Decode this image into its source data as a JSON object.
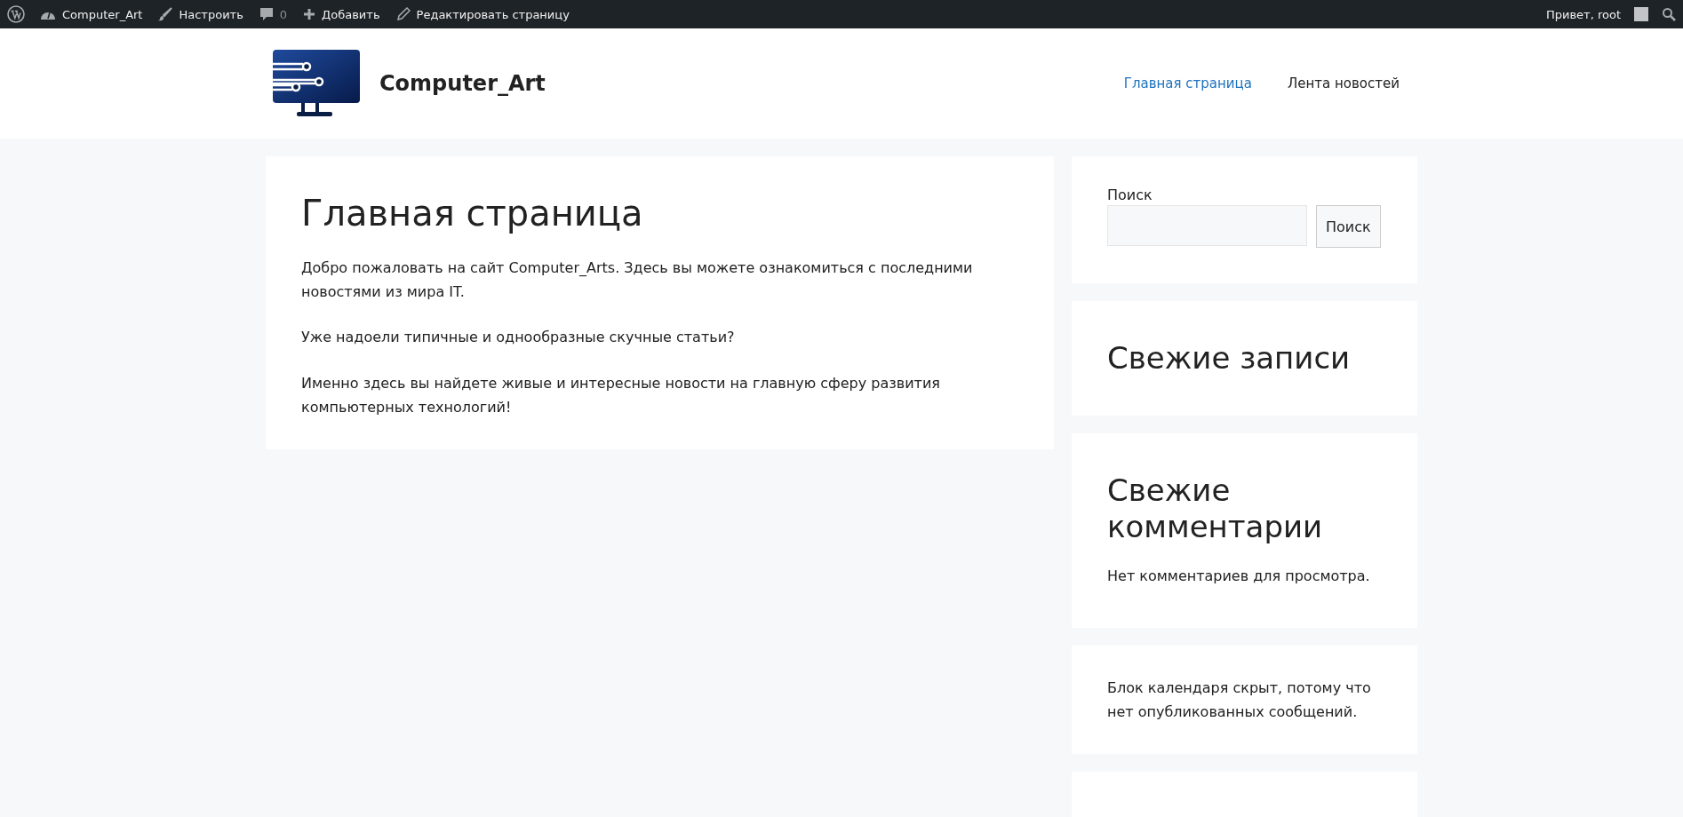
{
  "admin_bar": {
    "items": [
      {
        "kind": "wordpress"
      },
      {
        "kind": "site",
        "label": "Computer_Art"
      },
      {
        "kind": "customize",
        "label": "Настроить"
      },
      {
        "kind": "comments",
        "label": "0"
      },
      {
        "kind": "new",
        "label": "Добавить"
      },
      {
        "kind": "edit",
        "label": "Редактировать страницу"
      }
    ],
    "greeting": "Привет, root"
  },
  "header": {
    "site_title": "Computer_Art",
    "nav": [
      {
        "label": "Главная страница",
        "selected": true
      },
      {
        "label": "Лента новостей",
        "selected": false
      }
    ]
  },
  "article": {
    "title": "Главная страница",
    "paragraphs": [
      "Добро пожаловать на сайт Computer_Arts. Здесь вы можете ознакомиться с последними новостями из мира IT.",
      "Уже надоели типичные и однообразные скучные статьи?",
      "Именно здесь вы найдете живые и интересные новости на главную сферу развития компьютерных технологий!"
    ]
  },
  "sidebar": [
    {
      "kind": "search",
      "label": "Поиск",
      "button": "Поиск"
    },
    {
      "kind": "heading",
      "title": "Свежие записи"
    },
    {
      "kind": "heading",
      "title": "Свежие комментарии",
      "text": "Нет комментариев для просмотра."
    },
    {
      "kind": "text",
      "text": "Блок календаря скрыт, потому что нет опубликованных сообщений."
    },
    {
      "kind": "empty"
    }
  ]
}
